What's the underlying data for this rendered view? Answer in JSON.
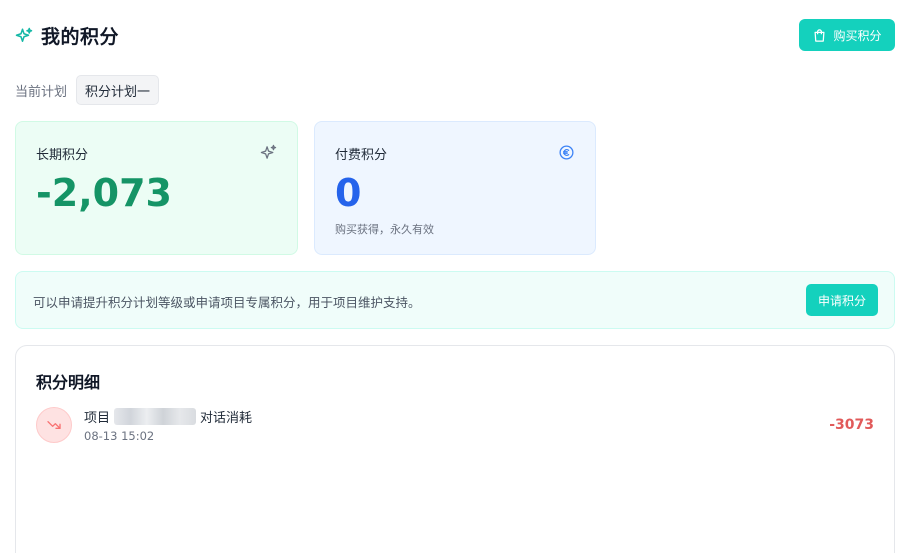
{
  "header": {
    "title": "我的积分",
    "title_icon": "sparkle-icon",
    "buy_button_label": "购买积分",
    "buy_button_icon": "shopping-bag-icon"
  },
  "plan": {
    "label": "当前计划",
    "value": "积分计划一"
  },
  "cards": {
    "long_term": {
      "label": "长期积分",
      "value": "-2,073",
      "icon": "sparkle-icon"
    },
    "paid": {
      "label": "付费积分",
      "value": "0",
      "subtext": "购买获得，永久有效",
      "icon": "coin-icon"
    }
  },
  "notice": {
    "text": "可以申请提升积分计划等级或申请项目专属积分，用于项目维护支持。",
    "button_label": "申请积分"
  },
  "details": {
    "title": "积分明细",
    "records": [
      {
        "desc_prefix": "项目",
        "desc_suffix": "对话消耗",
        "time": "08-13 15:02",
        "amount": "-3073",
        "icon": "trending-down-icon"
      }
    ]
  },
  "colors": {
    "accent": "#14d1bd",
    "positive_green": "#159466",
    "paid_blue": "#2563eb",
    "negative_red": "#e15a5a"
  }
}
